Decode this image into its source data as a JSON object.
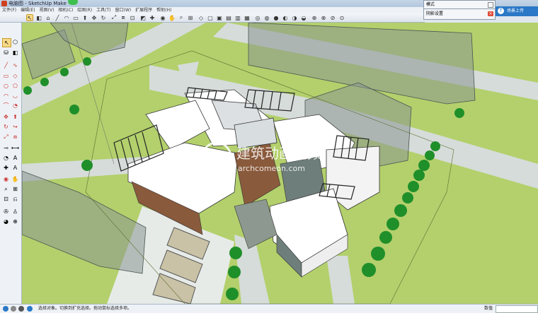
{
  "window": {
    "title": "电脑图 - SketchUp Make"
  },
  "menubar": {
    "items": [
      "文件(F)",
      "编辑(E)",
      "视图(V)",
      "相机(C)",
      "绘图(R)",
      "工具(T)",
      "窗口(W)",
      "扩展程序",
      "帮助(H)"
    ]
  },
  "panels": {
    "mode_label": "模式",
    "scene_label": "阴影设置"
  },
  "upload_button": "场景上传",
  "status": {
    "message": "选择对象。切换到扩充选择。拖动鼠标选择多项。",
    "measure_label": "数值",
    "measure_value": ""
  },
  "watermark": {
    "line1": "建筑动画视频",
    "line2": "archcomeon.com"
  },
  "colors": {
    "grass": "#b3d06c",
    "road": "#d6dcd9",
    "roof": "#ffffff",
    "brick": "#8a5a3c",
    "glass": "#6e7e7a",
    "tree": "#1f8f2a",
    "selection_accent": "#f7d987"
  },
  "toolbar": {
    "icons": [
      "select-icon",
      "eraser-icon",
      "paint-icon",
      "line-icon",
      "arc-icon",
      "shapes-icon",
      "pushpull-icon",
      "move-icon",
      "rotate-icon",
      "scale-icon",
      "offset-icon",
      "tape-icon",
      "text-icon",
      "axes-icon",
      "orbit-icon",
      "pan-icon",
      "zoom-icon",
      "zoom-extents-icon",
      "iso-view-icon",
      "top-view-icon",
      "front-view-icon",
      "right-view-icon",
      "back-view-icon",
      "left-view-icon",
      "xray-icon",
      "wireframe-icon",
      "hidden-line-icon",
      "shaded-icon",
      "textured-icon",
      "monochrome-icon",
      "section-icon",
      "components-icon",
      "warehouse-icon",
      "share-icon",
      "extension-icon",
      "layers-icon",
      "styles-icon",
      "shadows-icon",
      "fog-icon",
      "scenes-icon",
      "outliner-icon",
      "entity-info-icon",
      "materials-icon",
      "undo-icon",
      "redo-icon"
    ]
  }
}
